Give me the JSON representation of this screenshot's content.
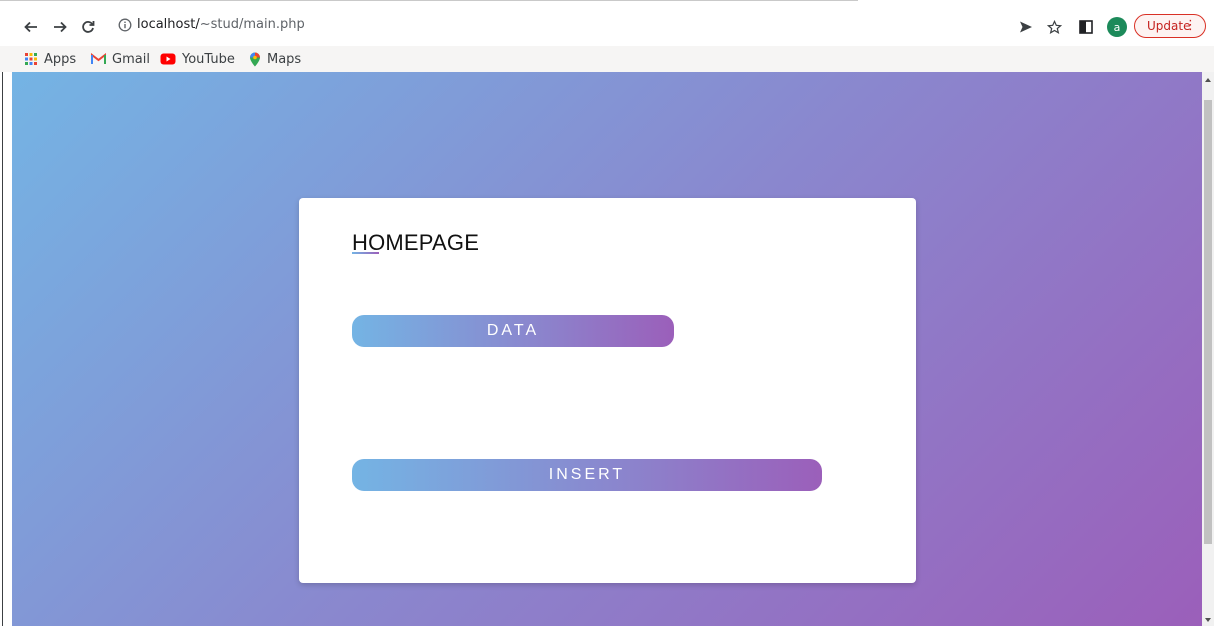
{
  "browser": {
    "url_host": "localhost/",
    "url_path": "~stud/main.php",
    "avatar_letter": "a",
    "update_label": "Update",
    "update_menu_glyph": "⋮",
    "colors": {
      "avatar": "#1c8a5a",
      "update": "#c5221f"
    }
  },
  "bookmarks": [
    {
      "label": "Apps",
      "icon": "apps-grid-icon"
    },
    {
      "label": "Gmail",
      "icon": "gmail-icon"
    },
    {
      "label": "YouTube",
      "icon": "youtube-icon"
    },
    {
      "label": "Maps",
      "icon": "maps-pin-icon"
    }
  ],
  "page": {
    "title": "HOMEPAGE",
    "buttons": {
      "data": "DATA",
      "insert": "INSERT"
    },
    "colors": {
      "gradient_start": "#74b4e4",
      "gradient_end": "#9b5fba"
    }
  }
}
